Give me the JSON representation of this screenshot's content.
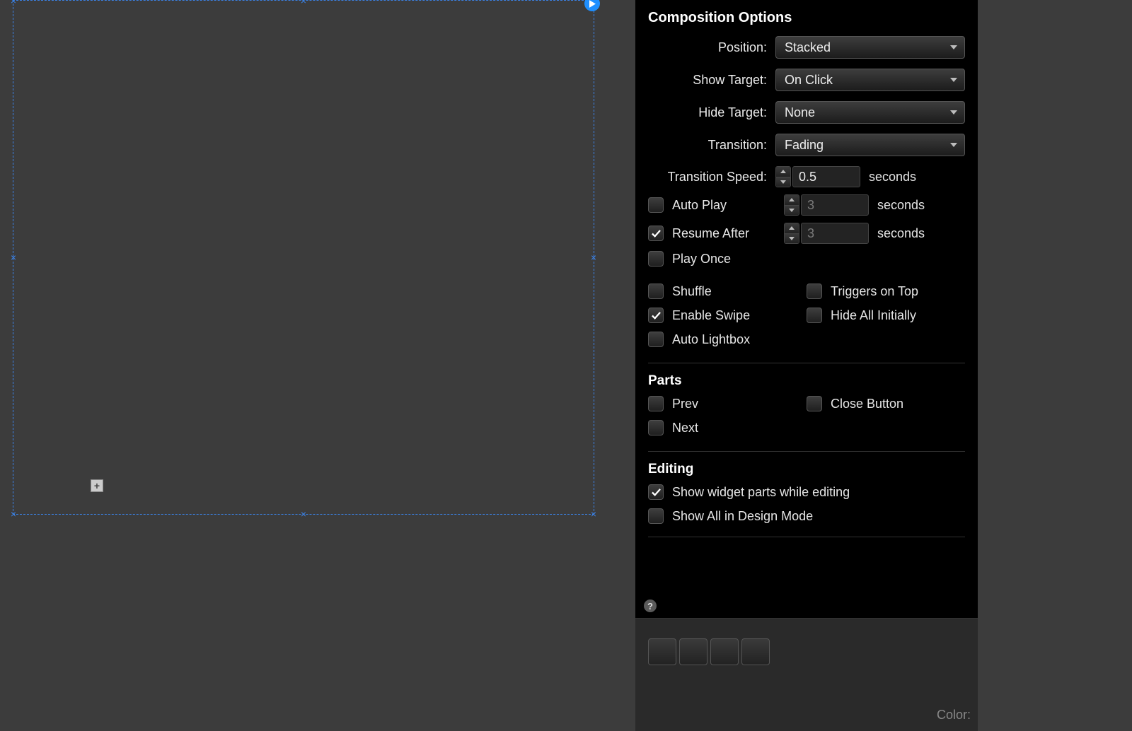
{
  "panel_title": "Composition Options",
  "labels": {
    "position": "Position:",
    "show_target": "Show Target:",
    "hide_target": "Hide Target:",
    "transition": "Transition:",
    "transition_speed": "Transition Speed:",
    "seconds": "seconds"
  },
  "selects": {
    "position": "Stacked",
    "show_target": "On Click",
    "hide_target": "None",
    "transition": "Fading"
  },
  "spinners": {
    "transition_speed": "0.5",
    "auto_play": "3",
    "resume_after": "3"
  },
  "checkboxes": {
    "auto_play": {
      "label": "Auto Play",
      "checked": false
    },
    "resume_after": {
      "label": "Resume After",
      "checked": true
    },
    "play_once": {
      "label": "Play Once",
      "checked": false
    },
    "shuffle": {
      "label": "Shuffle",
      "checked": false
    },
    "triggers_on_top": {
      "label": "Triggers on Top",
      "checked": false
    },
    "enable_swipe": {
      "label": "Enable Swipe",
      "checked": true
    },
    "hide_all_initially": {
      "label": "Hide All Initially",
      "checked": false
    },
    "auto_lightbox": {
      "label": "Auto Lightbox",
      "checked": false
    },
    "prev": {
      "label": "Prev",
      "checked": false
    },
    "close_button": {
      "label": "Close Button",
      "checked": false
    },
    "next": {
      "label": "Next",
      "checked": false
    },
    "show_parts_editing": {
      "label": "Show widget parts while editing",
      "checked": true
    },
    "show_all_design": {
      "label": "Show All in Design Mode",
      "checked": false
    }
  },
  "sections": {
    "parts": "Parts",
    "editing": "Editing"
  },
  "footer": {
    "color_label": "Color:"
  }
}
